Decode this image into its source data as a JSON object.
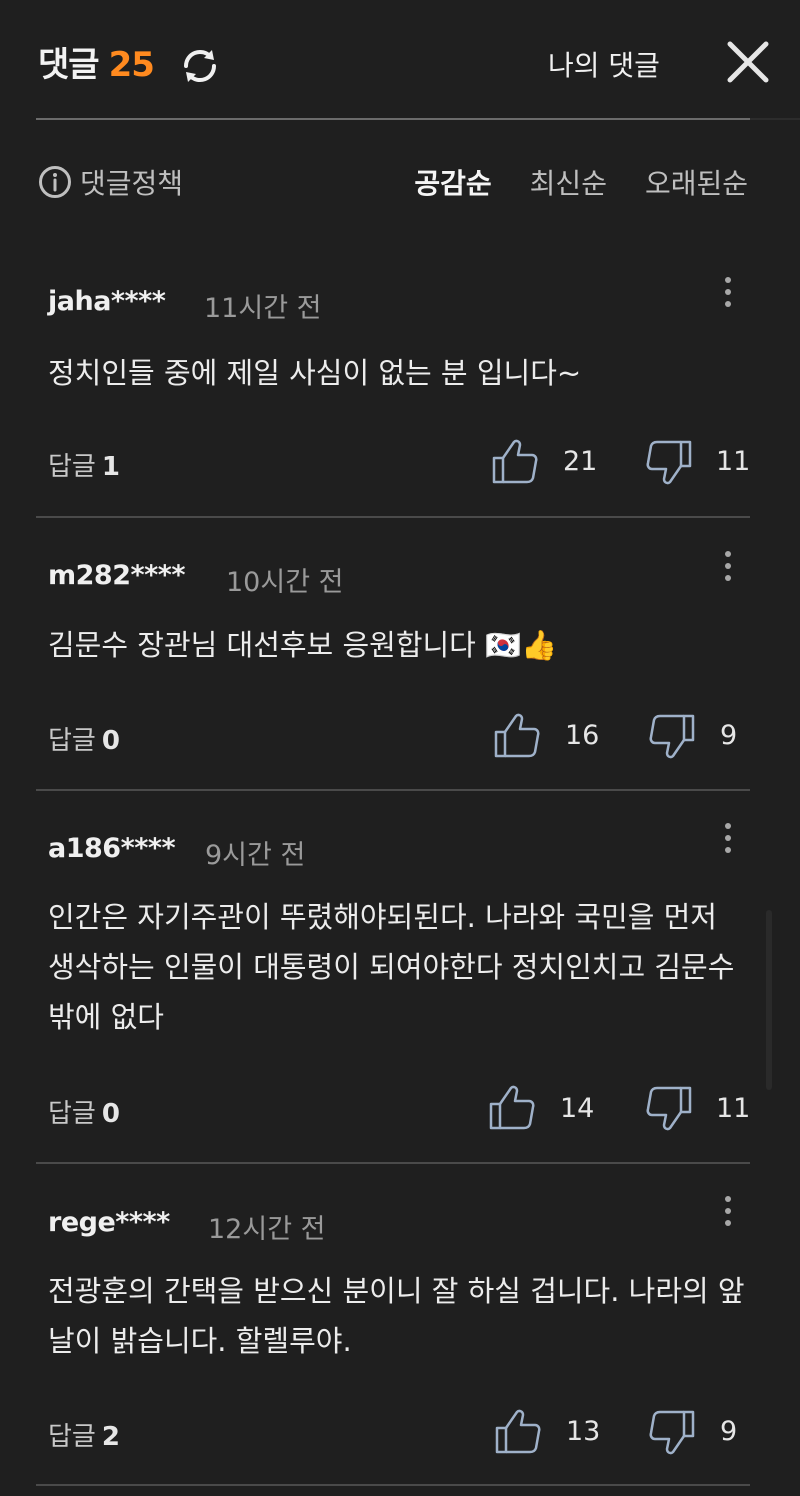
{
  "header": {
    "title": "댓글",
    "count": "25",
    "my_comments": "나의 댓글"
  },
  "toolbar": {
    "policy_label": "댓글정책",
    "sort_options": [
      "공감순",
      "최신순",
      "오래된순"
    ],
    "active_sort": "공감순"
  },
  "comments": [
    {
      "user": "jaha****",
      "time": "11시간 전",
      "text": "정치인들 중에 제일 사심이 없는 분 입니다~",
      "reply_label": "답글",
      "reply_count": "1",
      "likes": "21",
      "dislikes": "11"
    },
    {
      "user": "m282****",
      "time": "10시간 전",
      "text": "김문수 장관님 대선후보 응원합니다 🇰🇷👍",
      "reply_label": "답글",
      "reply_count": "0",
      "likes": "16",
      "dislikes": "9"
    },
    {
      "user": "a186****",
      "time": "9시간 전",
      "text": "인간은 자기주관이 뚜렸해야되된다. 나라와 국민을 먼저 생삭하는 인물이 대통령이 되여야한다 정치인치고 김문수밖에 없다",
      "reply_label": "답글",
      "reply_count": "0",
      "likes": "14",
      "dislikes": "11"
    },
    {
      "user": "rege****",
      "time": "12시간 전",
      "text": "전광훈의 간택을 받으신 분이니 잘 하실 겁니다. 나라의 앞날이 밝습니다. 할렐루야.",
      "reply_label": "답글",
      "reply_count": "2",
      "likes": "13",
      "dislikes": "9"
    }
  ],
  "colors": {
    "background": "#1f1f1f",
    "accent": "#ff8a1f",
    "divider": "#4a4a4a"
  },
  "icons": [
    "refresh-icon",
    "close-icon",
    "info-icon",
    "more-vertical-icon",
    "thumbs-up-icon",
    "thumbs-down-icon"
  ]
}
